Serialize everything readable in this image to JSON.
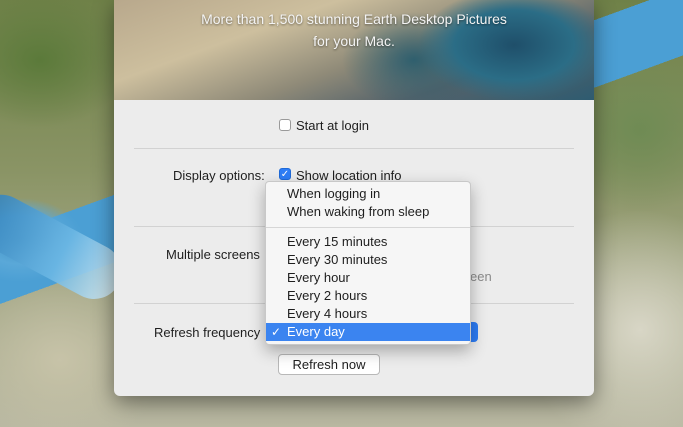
{
  "banner": {
    "line1": "More than 1,500 stunning Earth Desktop Pictures",
    "line2": "for your Mac."
  },
  "start_at_login": {
    "label": "Start at login",
    "checked": false
  },
  "display_options": {
    "label": "Display options:",
    "show_location": {
      "label": "Show location info",
      "checked": true
    }
  },
  "multiple_screens": {
    "label": "Multiple screens",
    "option_partial": "een"
  },
  "refresh_frequency": {
    "label": "Refresh frequency",
    "selected": "Every day"
  },
  "refresh_now_label": "Refresh now",
  "menu": {
    "group1": [
      "When logging in",
      "When waking from sleep"
    ],
    "group2": [
      "Every 15 minutes",
      "Every 30 minutes",
      "Every hour",
      "Every 2 hours",
      "Every 4 hours",
      "Every day"
    ],
    "checkmark": "✓"
  },
  "colors": {
    "accent": "#2d7df6",
    "selection": "#3b84f0",
    "panel": "#ececec"
  }
}
